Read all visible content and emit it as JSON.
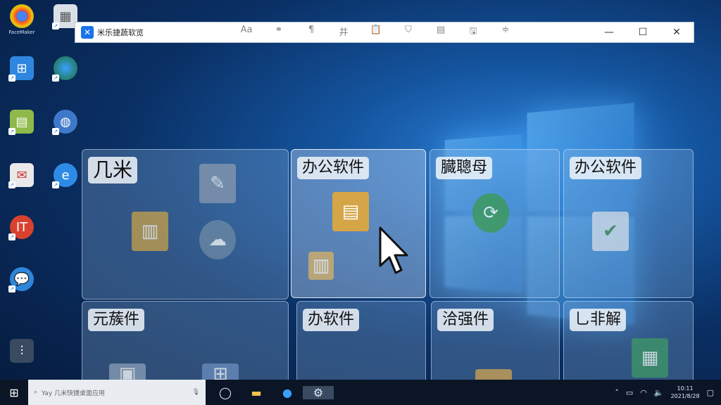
{
  "window": {
    "title": "米乐捷蔬软览",
    "toolbar": [
      {
        "name": "text-tool-icon",
        "glyph": "Aa"
      },
      {
        "name": "link-tool-icon",
        "glyph": "⚭"
      },
      {
        "name": "format-tool-icon",
        "glyph": "¶"
      },
      {
        "name": "grid-tool-icon",
        "glyph": "井"
      },
      {
        "name": "clipboard-tool-icon",
        "glyph": "📋"
      },
      {
        "name": "shield-tool-icon",
        "glyph": "⛉"
      },
      {
        "name": "note-tool-icon",
        "glyph": "▤"
      },
      {
        "name": "save-tool-icon",
        "glyph": "🖫"
      },
      {
        "name": "sliders-tool-icon",
        "glyph": "≑"
      }
    ],
    "controls": {
      "minimize": "—",
      "maximize": "☐",
      "close": "✕"
    }
  },
  "tiles": [
    {
      "label": "几米"
    },
    {
      "label": "办公软件"
    },
    {
      "label": "臓聰母"
    },
    {
      "label": "办公软件"
    },
    {
      "label": "元蔟件"
    },
    {
      "label": "办软件"
    },
    {
      "label": "洽强件"
    },
    {
      "label": "乚非解"
    }
  ],
  "desktop_icons": [
    {
      "label": "FaceMaker"
    },
    {
      "label": ""
    },
    {
      "label": ""
    },
    {
      "label": ""
    },
    {
      "label": ""
    },
    {
      "label": ""
    },
    {
      "label": ""
    },
    {
      "label": ""
    },
    {
      "label": ""
    },
    {
      "label": ""
    },
    {
      "label": ""
    }
  ],
  "taskbar": {
    "search_placeholder": "Yay 几米快捷桌面应用",
    "clock_time": "10:11",
    "clock_date": "2021/8/28"
  },
  "colors": {
    "accent": "#1a73e8",
    "taskbar": "#0b1526",
    "desktop": "#0a2f63"
  }
}
